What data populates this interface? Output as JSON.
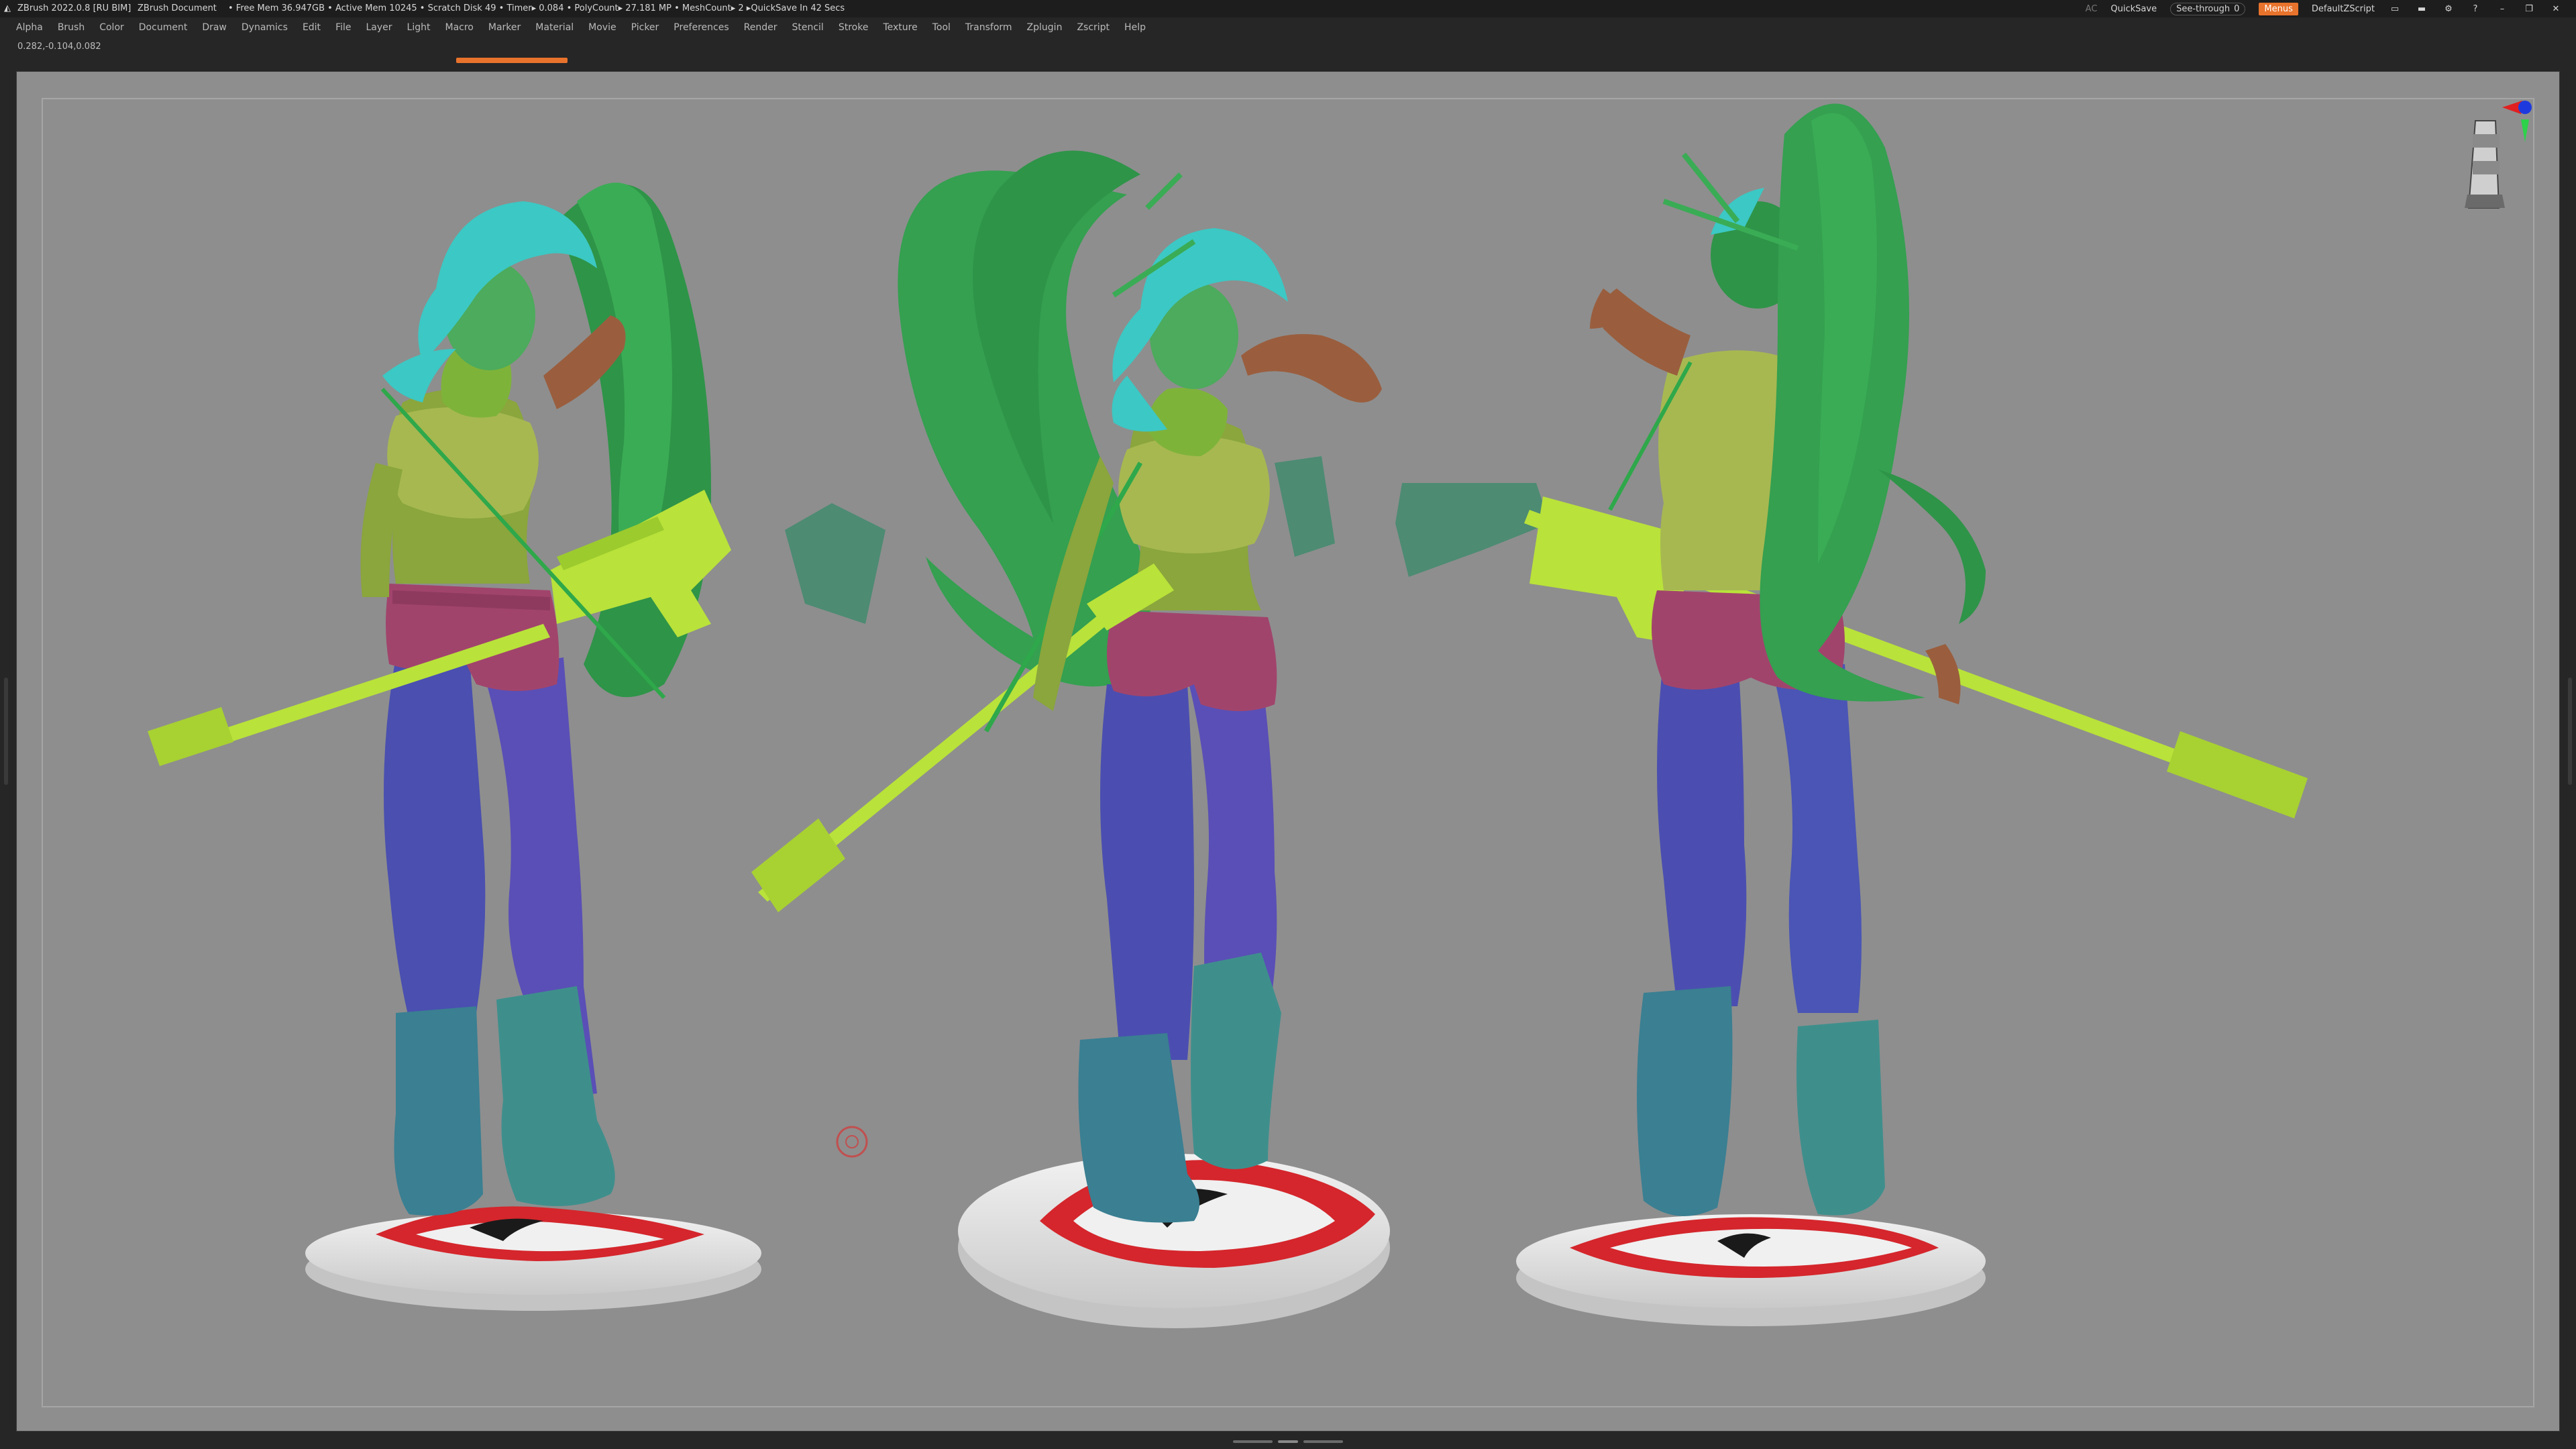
{
  "titlebar": {
    "app_title": "ZBrush 2022.0.8 [RU BIM]",
    "document": "ZBrush Document",
    "status": "• Free Mem 36.947GB • Active Mem 10245 • Scratch Disk 49 • Timer▸ 0.084 • PolyCount▸ 27.181 MP • MeshCount▸ 2 ▸QuickSave In 42 Secs",
    "ac": "AC",
    "quicksave": "QuickSave",
    "see_through_label": "See-through",
    "see_through_value": "0",
    "menus": "Menus",
    "script": "DefaultZScript"
  },
  "menubar": [
    "Alpha",
    "Brush",
    "Color",
    "Document",
    "Draw",
    "Dynamics",
    "Edit",
    "File",
    "Layer",
    "Light",
    "Macro",
    "Marker",
    "Material",
    "Movie",
    "Picker",
    "Preferences",
    "Render",
    "Stencil",
    "Stroke",
    "Texture",
    "Tool",
    "Transform",
    "Zplugin",
    "Zscript",
    "Help"
  ],
  "coords": "0.282,-0.104,0.082",
  "icons": {
    "app": "zbrush-logo-icon",
    "gizmo": "navigation-cube-icon",
    "cursor": "brush-cursor-icon"
  },
  "colors": {
    "accent": "#e8732c",
    "canvas": "#8e8e8e",
    "hair_green": "#36a24e",
    "hair_cyan": "#3cc8c4",
    "skin": "#8aa63c",
    "top": "#a7b851",
    "shorts": "#a1446c",
    "leggings": "#4b4eb0",
    "boots": "#3d8a90",
    "rifle": "#b9e23a",
    "arm": "#9a5e3e",
    "base": "#e9e9e9",
    "emblem": "#d4262c"
  }
}
